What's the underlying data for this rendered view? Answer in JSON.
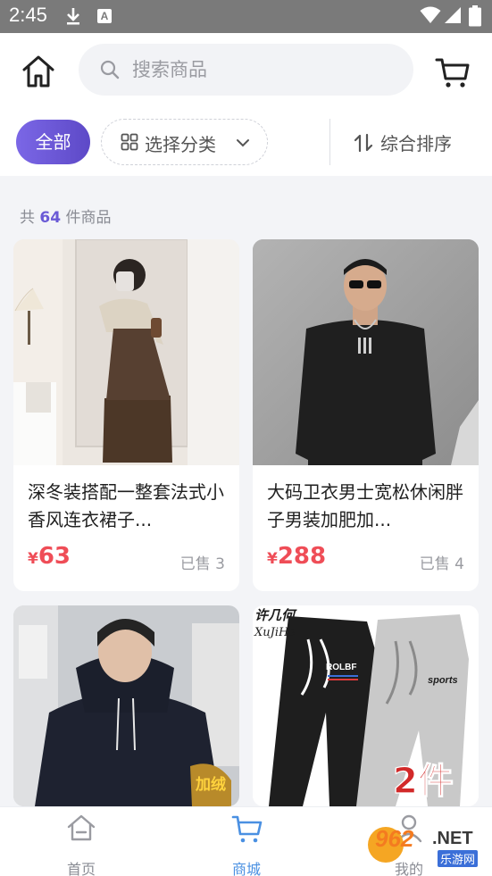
{
  "status_bar": {
    "time": "2:45",
    "a_badge": "A"
  },
  "search": {
    "placeholder": "搜索商品"
  },
  "filters": {
    "all": "全部",
    "category": "选择分类",
    "sort": "综合排序"
  },
  "count": {
    "prefix": "共",
    "value": "64",
    "suffix": "件商品"
  },
  "products": [
    {
      "title": "深冬装搭配一整套法式小香风连衣裙子...",
      "currency": "¥",
      "price": "63",
      "sold": "已售 3"
    },
    {
      "title": "大码卫衣男士宽松休闲胖子男装加肥加...",
      "currency": "¥",
      "price": "288",
      "sold": "已售 4"
    },
    {
      "title": "",
      "currency": "",
      "price": "",
      "sold": ""
    },
    {
      "title": "",
      "currency": "",
      "price": "",
      "sold": ""
    }
  ],
  "image_text": {
    "brand": "许几何",
    "brand_latin": "XuJiHe",
    "logo": "ROLBF",
    "sports": "sports",
    "badge": "2件",
    "jiarong": "加绒"
  },
  "nav": [
    {
      "label": "首页",
      "icon": "home-icon",
      "active": false
    },
    {
      "label": "商城",
      "icon": "cart-icon",
      "active": true
    },
    {
      "label": "我的",
      "icon": "person-icon",
      "active": false
    }
  ],
  "watermark": {
    "number": "962",
    "suffix": ".NET",
    "site": "乐游网"
  },
  "colors": {
    "accent": "#6a5ad6",
    "price": "#ef4d57",
    "nav_active": "#4a90e2"
  }
}
